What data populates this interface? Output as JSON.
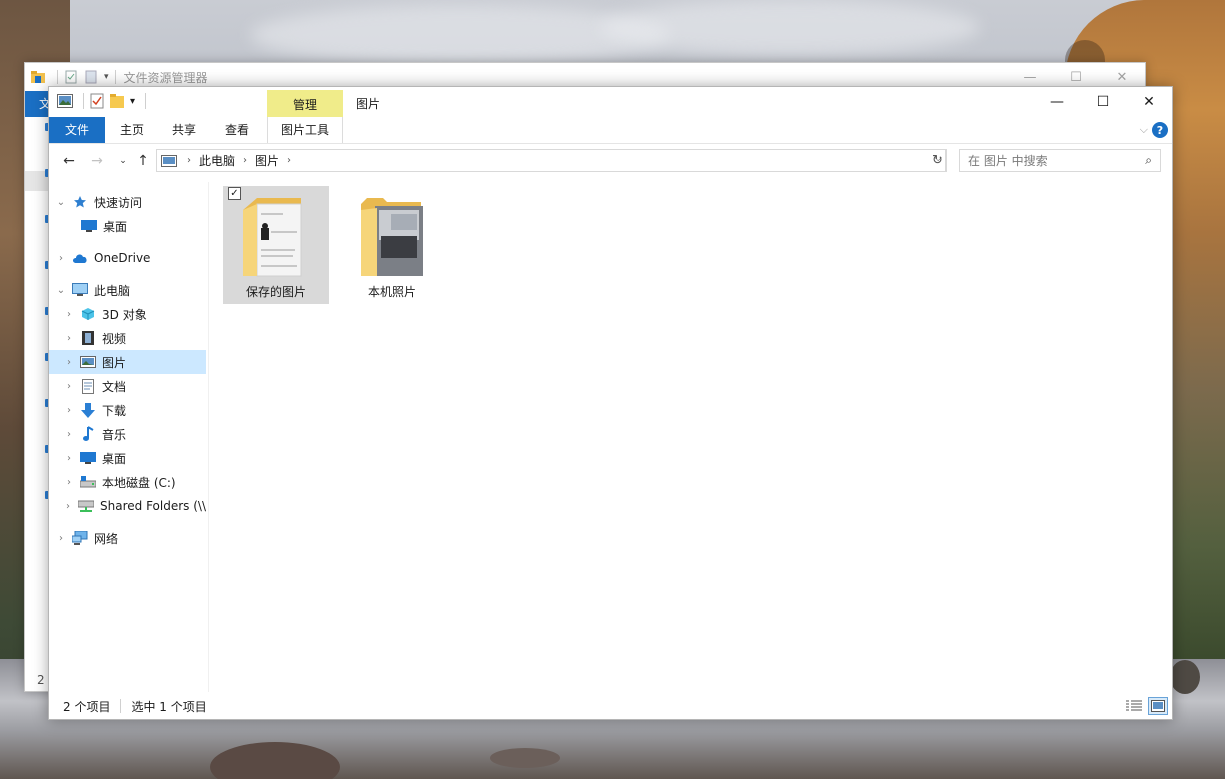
{
  "background_window": {
    "title": "文件资源管理器",
    "file_tab": "文件",
    "item_count": "2"
  },
  "window": {
    "title": "图片",
    "context_tab_group": "管理",
    "minimize": "—",
    "maximize": "☐",
    "close": "✕"
  },
  "ribbon": {
    "tabs": [
      "文件",
      "主页",
      "共享",
      "查看",
      "图片工具"
    ],
    "help": "?"
  },
  "address": {
    "crumbs": [
      "此电脑",
      "图片"
    ]
  },
  "search": {
    "placeholder": "在 图片 中搜索"
  },
  "nav": {
    "items": [
      {
        "label": "快速访问",
        "icon": "star-icon"
      },
      {
        "label": "桌面",
        "icon": "desktop-icon"
      },
      {
        "label": "OneDrive",
        "icon": "cloud-icon"
      },
      {
        "label": "此电脑",
        "icon": "computer-icon"
      },
      {
        "label": "3D 对象",
        "icon": "cube-icon"
      },
      {
        "label": "视频",
        "icon": "film-icon"
      },
      {
        "label": "图片",
        "icon": "picture-icon"
      },
      {
        "label": "文档",
        "icon": "document-icon"
      },
      {
        "label": "下载",
        "icon": "download-arrow-icon"
      },
      {
        "label": "音乐",
        "icon": "music-note-icon"
      },
      {
        "label": "桌面",
        "icon": "desktop-icon"
      },
      {
        "label": "本地磁盘 (C:)",
        "icon": "drive-icon"
      },
      {
        "label": "Shared Folders (\\\\",
        "icon": "network-drive-icon"
      },
      {
        "label": "网络",
        "icon": "network-icon"
      }
    ]
  },
  "files": [
    {
      "name": "保存的图片",
      "selected": true
    },
    {
      "name": "本机照片",
      "selected": false
    }
  ],
  "status": {
    "count": "2 个项目",
    "selection": "选中 1 个项目"
  },
  "colors": {
    "accent": "#1a6fc4",
    "selection": "#cce8ff",
    "context_tab": "#f0ec8a",
    "folder": "#f6d57a"
  }
}
